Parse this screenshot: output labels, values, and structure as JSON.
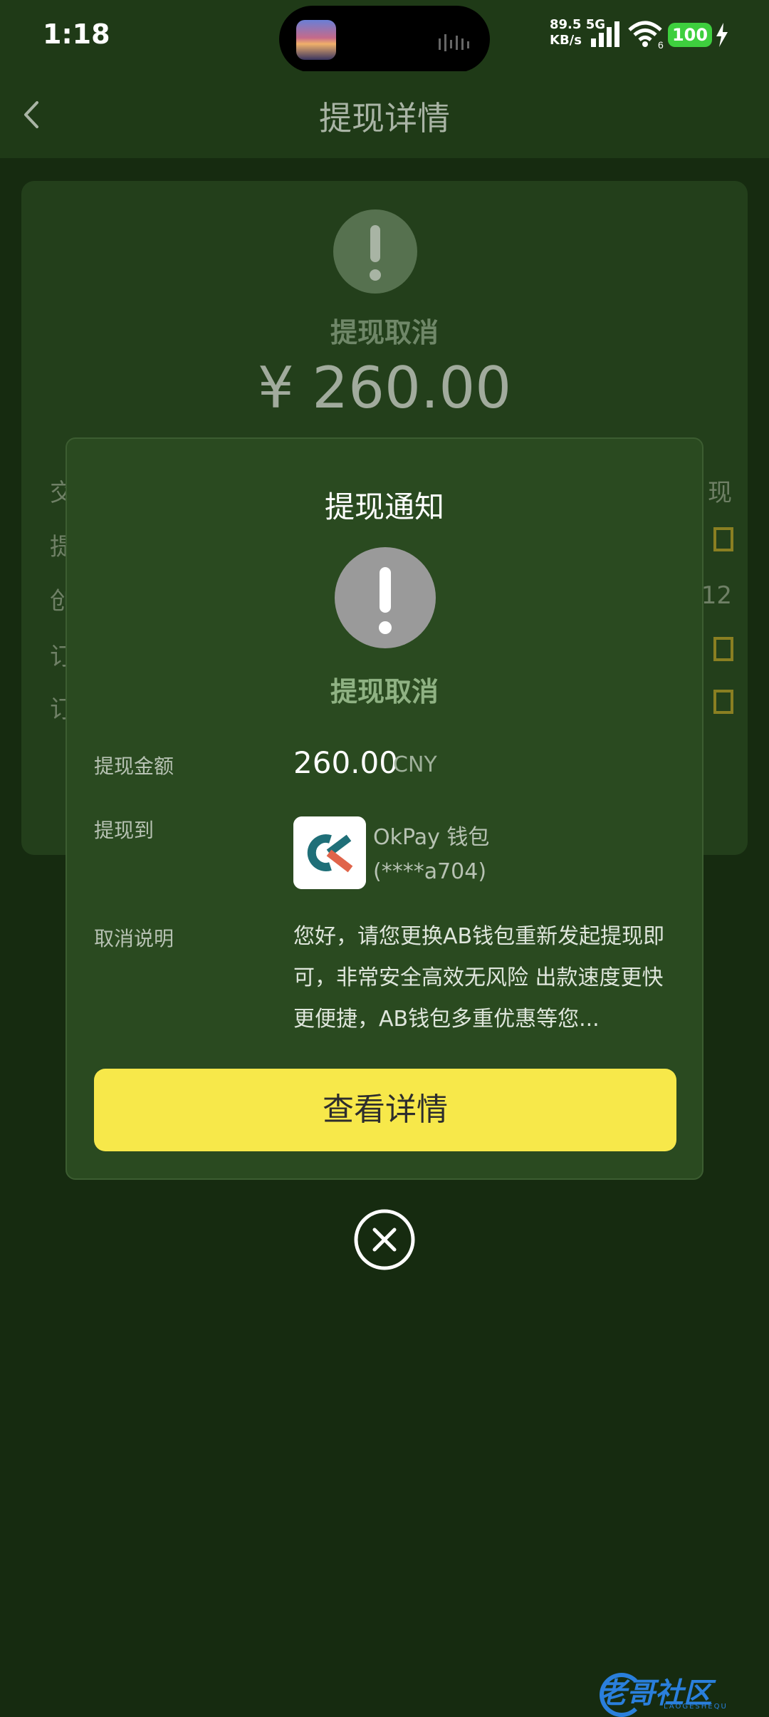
{
  "status_bar": {
    "time": "1:18",
    "net_speed_value": "89.5",
    "net_speed_unit": "KB/s",
    "network_type": "5G",
    "wifi_label": "6",
    "battery": "100"
  },
  "header": {
    "title": "提现详情"
  },
  "background_card": {
    "status_text": "提现取消",
    "amount": "¥ 260.00",
    "rows_left": [
      "交",
      "提",
      "创",
      "订",
      "订"
    ],
    "row_right_text_1": "现",
    "row_right_text_3": "12"
  },
  "modal": {
    "title": "提现通知",
    "status_text": "提现取消",
    "amount_label": "提现金额",
    "amount_value": "260.00",
    "amount_currency": "CNY",
    "destination_label": "提现到",
    "wallet_name": "OkPay 钱包",
    "wallet_account": "(****a704)",
    "cancel_label": "取消说明",
    "cancel_description": "您好，请您更换AB钱包重新发起提现即可，非常安全高效无风险 出款速度更快更便捷，AB钱包多重优惠等您...",
    "details_button": "查看详情"
  },
  "watermark": {
    "text": "老哥社区",
    "subtext": "LAOGESHEQU"
  },
  "colors": {
    "background": "#162b10",
    "modal": "#2a4a20",
    "button": "#f7e84a",
    "status_green": "#8fb283"
  }
}
